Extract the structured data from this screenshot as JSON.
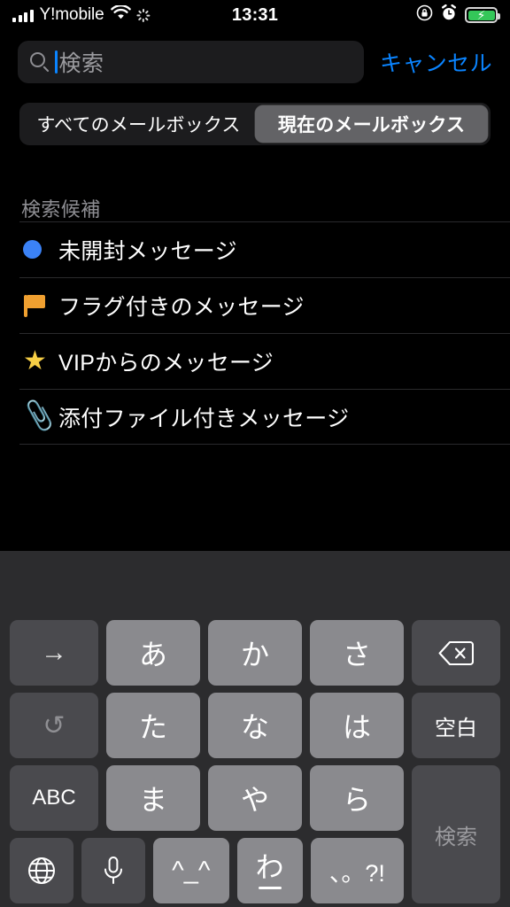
{
  "status_bar": {
    "carrier": "Y!mobile",
    "time": "13:31",
    "signal_icon": "cellular-bars-icon",
    "wifi_icon": "wifi-icon",
    "activity_icon": "activity-spinner-icon",
    "rotation_lock_icon": "rotation-lock-icon",
    "alarm_icon": "alarm-clock-icon",
    "battery_icon": "battery-charging-icon",
    "battery_color": "#34c759"
  },
  "search": {
    "icon": "search-icon",
    "placeholder": "検索",
    "value": "",
    "cancel_label": "キャンセル",
    "accent_color": "#0a84ff"
  },
  "scope_bar": {
    "segments": [
      {
        "label": "すべてのメールボックス",
        "selected": false
      },
      {
        "label": "現在のメールボックス",
        "selected": true
      }
    ],
    "selected_bg": "#636366"
  },
  "suggestions": {
    "header": "検索候補",
    "items": [
      {
        "icon": "unread-dot-icon",
        "label": "未開封メッセージ",
        "color": "#3b82f6"
      },
      {
        "icon": "flag-icon",
        "label": "フラグ付きのメッセージ",
        "color": "#f0a030"
      },
      {
        "icon": "star-icon",
        "label": "VIPからのメッセージ",
        "color": "#f7cf46"
      },
      {
        "icon": "paperclip-icon",
        "label": "添付ファイル付きメッセージ",
        "color": "#8e8e93"
      }
    ]
  },
  "keyboard": {
    "layout": "japanese-kana-10key",
    "rows": [
      [
        {
          "name": "next-candidate-key",
          "label": "→",
          "style": "dark",
          "icon": "arrow-right-icon"
        },
        {
          "name": "kana-a-key",
          "label": "あ",
          "style": "light"
        },
        {
          "name": "kana-ka-key",
          "label": "か",
          "style": "light"
        },
        {
          "name": "kana-sa-key",
          "label": "さ",
          "style": "light"
        },
        {
          "name": "backspace-key",
          "label": "",
          "style": "dark",
          "icon": "backspace-icon"
        }
      ],
      [
        {
          "name": "undo-key",
          "label": "",
          "style": "dark",
          "icon": "undo-icon"
        },
        {
          "name": "kana-ta-key",
          "label": "た",
          "style": "light"
        },
        {
          "name": "kana-na-key",
          "label": "な",
          "style": "light"
        },
        {
          "name": "kana-ha-key",
          "label": "は",
          "style": "light"
        },
        {
          "name": "space-key",
          "label": "空白",
          "style": "dark"
        }
      ],
      [
        {
          "name": "abc-key",
          "label": "ABC",
          "style": "dark"
        },
        {
          "name": "kana-ma-key",
          "label": "ま",
          "style": "light"
        },
        {
          "name": "kana-ya-key",
          "label": "や",
          "style": "light"
        },
        {
          "name": "kana-ra-key",
          "label": "ら",
          "style": "light"
        }
      ],
      [
        {
          "name": "globe-key",
          "label": "",
          "style": "dark",
          "icon": "globe-icon"
        },
        {
          "name": "dictation-key",
          "label": "",
          "style": "dark",
          "icon": "microphone-icon"
        },
        {
          "name": "emoticon-key",
          "label": "^_^",
          "style": "light"
        },
        {
          "name": "kana-wa-key",
          "label": "わ",
          "style": "light"
        },
        {
          "name": "punctuation-key",
          "label": "、。?!",
          "style": "light"
        }
      ]
    ],
    "enter_key": {
      "name": "search-enter-key",
      "label": "検索",
      "enabled": false
    }
  }
}
